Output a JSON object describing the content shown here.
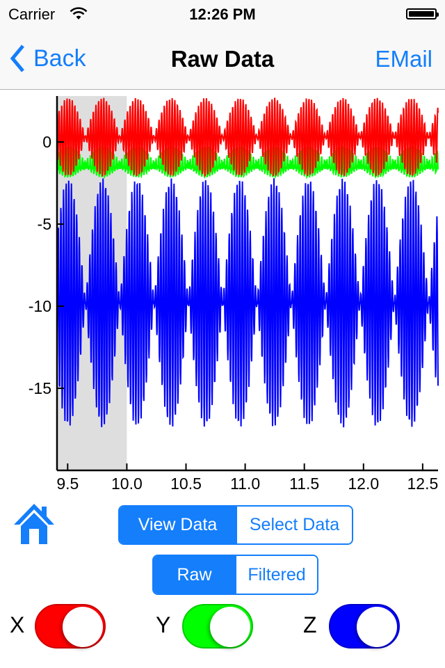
{
  "status_bar": {
    "carrier": "Carrier",
    "time": "12:26 PM",
    "wifi_icon": "wifi-icon",
    "battery_icon": "battery-full-icon"
  },
  "nav": {
    "back_label": "Back",
    "title": "Raw Data",
    "email_label": "EMail"
  },
  "colors": {
    "accent": "#147efb",
    "x_series": "#ff0000",
    "y_series": "#00ff00",
    "z_series": "#0000ff",
    "selection": "#dedede"
  },
  "chart_data": {
    "type": "line",
    "title": "",
    "xlabel": "",
    "ylabel": "",
    "xlim": [
      9.41,
      12.63
    ],
    "ylim": [
      -20.0,
      2.8
    ],
    "x_ticks": [
      "9.5",
      "10.0",
      "10.5",
      "11.0",
      "11.5",
      "12.0",
      "12.5"
    ],
    "x_tick_values": [
      9.5,
      10.0,
      10.5,
      11.0,
      11.5,
      12.0,
      12.5
    ],
    "y_ticks": [
      "0",
      "-5",
      "-10",
      "-15"
    ],
    "y_tick_values": [
      0,
      -5,
      -10,
      -15
    ],
    "grid": false,
    "selection_range": [
      9.41,
      10.0
    ],
    "series": [
      {
        "name": "X",
        "color": "#ff0000",
        "center": 0.3,
        "envelope_amplitude": 2.4,
        "envelope_period": 0.29,
        "carrier_frequency": 45
      },
      {
        "name": "Y",
        "color": "#00ff00",
        "center": -1.4,
        "envelope_amplitude": 0.9,
        "envelope_period": 0.29,
        "carrier_frequency": 45
      },
      {
        "name": "Z",
        "color": "#0000ff",
        "center": -9.8,
        "envelope_amplitude": 7.6,
        "envelope_period": 0.29,
        "carrier_frequency": 45
      }
    ]
  },
  "controls": {
    "home_icon": "home-icon",
    "mode_segments": [
      {
        "label": "View Data",
        "selected": true
      },
      {
        "label": "Select Data",
        "selected": false
      }
    ],
    "data_segments": [
      {
        "label": "Raw",
        "selected": true
      },
      {
        "label": "Filtered",
        "selected": false
      }
    ],
    "toggles": [
      {
        "label": "X",
        "on": true,
        "color": "#ff0000"
      },
      {
        "label": "Y",
        "on": true,
        "color": "#00ff00"
      },
      {
        "label": "Z",
        "on": true,
        "color": "#0000ff"
      }
    ]
  }
}
